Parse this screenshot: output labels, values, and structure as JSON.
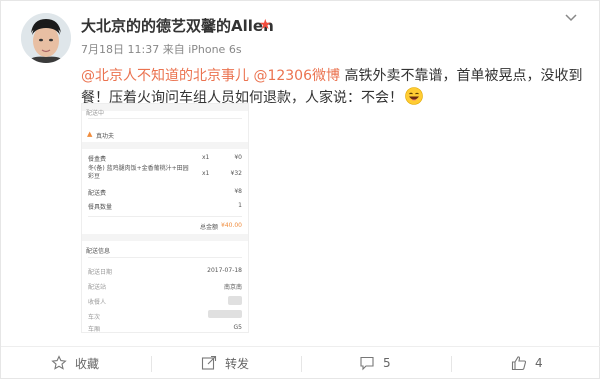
{
  "post": {
    "username": "大北京的的德艺双馨的Allen",
    "vip_icon": "star-icon",
    "time": "7月18日 11:37",
    "source": "来自 iPhone 6s",
    "mention1": "@北京人不知道的北京事儿",
    "mention2": "@12306微博",
    "text": " 高铁外卖不靠谱，首单被晃点，没收到餐！压着火询问车组人员如何退款，人家说：不会！",
    "emoji": "laughing-face-emoji"
  },
  "receipt": {
    "status": "配送中",
    "vendor": "真功夫",
    "rows": [
      {
        "label": "餐盒费",
        "qty": "x1",
        "price": "¥0"
      },
      {
        "label": "冬(备) 蓝鸡腿肉饭+金香葡桃汁+田园彩豆",
        "qty": "x1",
        "price": "¥32"
      },
      {
        "label": "配送费",
        "qty": "",
        "price": "¥8"
      },
      {
        "label": "餐具数量",
        "qty": "",
        "price": "1"
      }
    ],
    "total_label": "总金额",
    "total_value": "¥40.00",
    "delivery_header": "配送信息",
    "delivery_rows": [
      {
        "label": "配送日期",
        "value": "2017-07-18"
      },
      {
        "label": "配送站",
        "value": "南京南"
      },
      {
        "label": "收餐人",
        "value": ""
      },
      {
        "label": "车次",
        "value": ""
      },
      {
        "label": "车厢",
        "value": "G5"
      }
    ]
  },
  "actions": {
    "favorite_label": "收藏",
    "repost_label": "转发",
    "comment_count": "5",
    "like_count": "4"
  },
  "colors": {
    "accent": "#eb7350",
    "vip": "#f24c3d"
  }
}
